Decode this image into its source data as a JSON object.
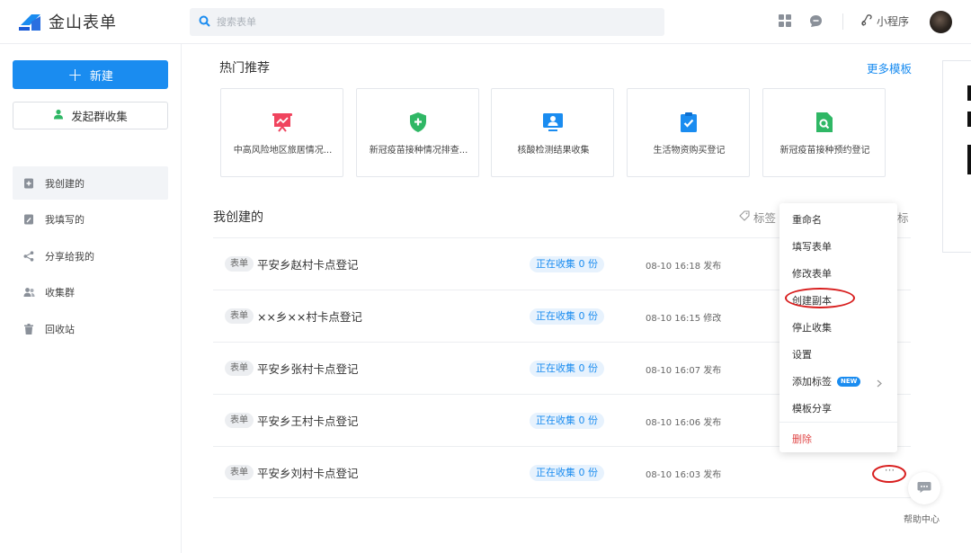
{
  "app": {
    "name": "金山表单"
  },
  "search": {
    "placeholder": "搜索表单"
  },
  "header": {
    "mini_program": "小程序"
  },
  "sidebar": {
    "new_button": "新建",
    "group_button": "发起群收集",
    "items": [
      {
        "label": "我创建的",
        "active": true
      },
      {
        "label": "我填写的",
        "active": false
      },
      {
        "label": "分享给我的",
        "active": false
      },
      {
        "label": "收集群",
        "active": false
      },
      {
        "label": "回收站",
        "active": false
      }
    ]
  },
  "hot": {
    "title": "热门推荐",
    "more": "更多模板",
    "templates": [
      {
        "name": "中高风险地区旅居情况...",
        "icon": "presentation-chart-icon",
        "color": "#f0445e"
      },
      {
        "name": "新冠疫苗接种情况排查...",
        "icon": "shield-plus-icon",
        "color": "#2fb765"
      },
      {
        "name": "核酸检测结果收集",
        "icon": "monitor-user-icon",
        "color": "#1a8cf0"
      },
      {
        "name": "生活物资购买登记",
        "icon": "clipboard-check-icon",
        "color": "#1a8cf0"
      },
      {
        "name": "新冠疫苗接种预约登记",
        "icon": "document-search-icon",
        "color": "#2fb765"
      }
    ]
  },
  "list": {
    "title": "我创建的",
    "tool_label": "标签",
    "tool_right": "标",
    "rows": [
      {
        "tag": "表单",
        "name": "平安乡赵村卡点登记",
        "status": "正在收集 0 份",
        "time": "08-10 16:18 发布"
      },
      {
        "tag": "表单",
        "name": "××乡××村卡点登记",
        "status": "正在收集 0 份",
        "time": "08-10 16:15 修改"
      },
      {
        "tag": "表单",
        "name": "平安乡张村卡点登记",
        "status": "正在收集 0 份",
        "time": "08-10 16:07 发布"
      },
      {
        "tag": "表单",
        "name": "平安乡王村卡点登记",
        "status": "正在收集 0 份",
        "time": "08-10 16:06 发布"
      },
      {
        "tag": "表单",
        "name": "平安乡刘村卡点登记",
        "status": "正在收集 0 份",
        "time": "08-10 16:03 发布"
      }
    ],
    "more": "···"
  },
  "menu": {
    "items": [
      "重命名",
      "填写表单",
      "修改表单",
      "创建副本",
      "停止收集",
      "设置",
      "添加标签",
      "模板分享"
    ],
    "badge": "NEW",
    "delete": "删除"
  },
  "help": {
    "label": "帮助中心"
  },
  "colors": {
    "accent": "#1a8cf0",
    "danger": "#e04848",
    "highlight_ring": "#d81e1e"
  }
}
